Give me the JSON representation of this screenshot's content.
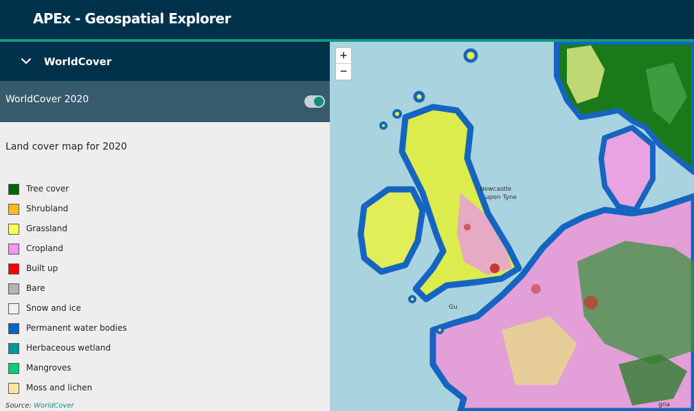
{
  "app": {
    "title": "APEx - Geospatial Explorer"
  },
  "section": {
    "title": "WorldCover"
  },
  "layer": {
    "name": "WorldCover 2020",
    "enabled": true,
    "description": "Land cover map for 2020"
  },
  "legend": [
    {
      "label": "Tree cover",
      "color": "#006400"
    },
    {
      "label": "Shrubland",
      "color": "#ffbb22"
    },
    {
      "label": "Grassland",
      "color": "#ffff4c"
    },
    {
      "label": "Cropland",
      "color": "#f096ff"
    },
    {
      "label": "Built up",
      "color": "#fa0000"
    },
    {
      "label": "Bare",
      "color": "#b4b4b4"
    },
    {
      "label": "Snow and ice",
      "color": "#f0f0f0"
    },
    {
      "label": "Permanent water bodies",
      "color": "#0064c8"
    },
    {
      "label": "Herbaceous wetland",
      "color": "#0096a0"
    },
    {
      "label": "Mangroves",
      "color": "#00cf75"
    },
    {
      "label": "Moss and lichen",
      "color": "#fae6a0"
    }
  ],
  "source": {
    "prefix": "Source:",
    "link": "WorldCover"
  },
  "map": {
    "zoom_in": "+",
    "zoom_out": "−",
    "place_labels": [
      "Newcastle",
      "upon Tyne",
      "Gu",
      "gna"
    ]
  },
  "colors": {
    "header": "#00314a",
    "accent": "#0f9a85",
    "layer_row": "#375a6c",
    "water": "#a9d3df"
  }
}
